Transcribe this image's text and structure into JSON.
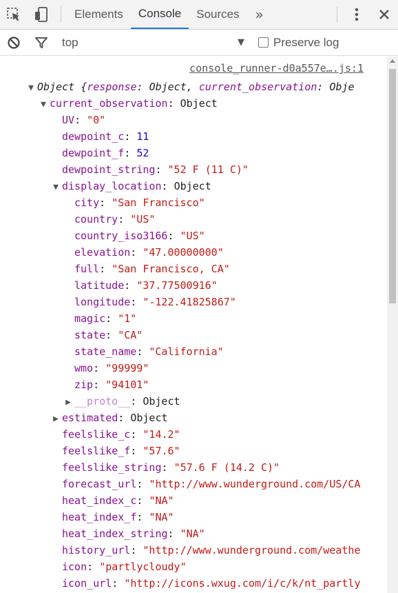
{
  "tabs": [
    "Elements",
    "Console",
    "Sources"
  ],
  "more_tabs": "»",
  "toolbar": {
    "context": "top",
    "preserve_log": "Preserve log"
  },
  "source_link": "console_runner-d0a557e….js:1",
  "object_summary": {
    "prefix": "Object {",
    "k1": "response",
    "v1": "Object",
    "k2": "current_observation",
    "v2": "Obje"
  },
  "current_observation": {
    "key": "current_observation",
    "type": "Object"
  },
  "fields_top": [
    {
      "key": "UV",
      "val": "\"0\"",
      "kind": "s"
    },
    {
      "key": "dewpoint_c",
      "val": "11",
      "kind": "n"
    },
    {
      "key": "dewpoint_f",
      "val": "52",
      "kind": "n"
    },
    {
      "key": "dewpoint_string",
      "val": "\"52 F (11 C)\"",
      "kind": "s"
    }
  ],
  "display_location": {
    "key": "display_location",
    "type": "Object"
  },
  "display_fields": [
    {
      "key": "city",
      "val": "\"San Francisco\""
    },
    {
      "key": "country",
      "val": "\"US\""
    },
    {
      "key": "country_iso3166",
      "val": "\"US\""
    },
    {
      "key": "elevation",
      "val": "\"47.00000000\""
    },
    {
      "key": "full",
      "val": "\"San Francisco, CA\""
    },
    {
      "key": "latitude",
      "val": "\"37.77500916\""
    },
    {
      "key": "longitude",
      "val": "\"-122.41825867\""
    },
    {
      "key": "magic",
      "val": "\"1\""
    },
    {
      "key": "state",
      "val": "\"CA\""
    },
    {
      "key": "state_name",
      "val": "\"California\""
    },
    {
      "key": "wmo",
      "val": "\"99999\""
    },
    {
      "key": "zip",
      "val": "\"94101\""
    }
  ],
  "proto": {
    "key": "__proto__",
    "type": "Object"
  },
  "estimated": {
    "key": "estimated",
    "type": "Object"
  },
  "fields_bottom": [
    {
      "key": "feelslike_c",
      "val": "\"14.2\""
    },
    {
      "key": "feelslike_f",
      "val": "\"57.6\""
    },
    {
      "key": "feelslike_string",
      "val": "\"57.6 F (14.2 C)\""
    },
    {
      "key": "forecast_url",
      "val": "\"http://www.wunderground.com/US/CA"
    },
    {
      "key": "heat_index_c",
      "val": "\"NA\""
    },
    {
      "key": "heat_index_f",
      "val": "\"NA\""
    },
    {
      "key": "heat_index_string",
      "val": "\"NA\""
    },
    {
      "key": "history_url",
      "val": "\"http://www.wunderground.com/weathe"
    },
    {
      "key": "icon",
      "val": "\"partlycloudy\""
    },
    {
      "key": "icon_url",
      "val": "\"http://icons.wxug.com/i/c/k/nt_partly"
    }
  ]
}
